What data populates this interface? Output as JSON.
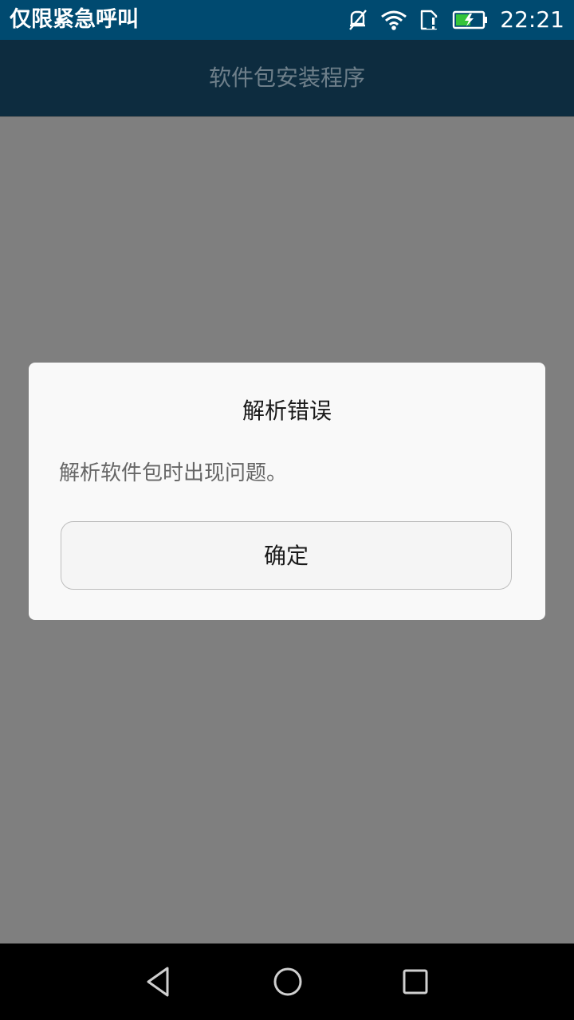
{
  "status_bar": {
    "carrier": "仅限紧急呼叫",
    "time": "22:21",
    "icons": [
      "mute-icon",
      "wifi-icon",
      "sim-alert-icon",
      "battery-charging-icon"
    ]
  },
  "app_bar": {
    "title": "软件包安装程序"
  },
  "dialog": {
    "title": "解析错误",
    "message": "解析软件包时出现问题。",
    "confirm_label": "确定"
  },
  "nav_bar": {
    "icons": [
      "back-icon",
      "home-icon",
      "recents-icon"
    ]
  },
  "colors": {
    "status_bar": "#004a70",
    "app_bar": "#0d2c3f",
    "scrim": "#7f7f7f",
    "dialog_bg": "#f9f9f9",
    "battery_fill": "#35c43a"
  }
}
